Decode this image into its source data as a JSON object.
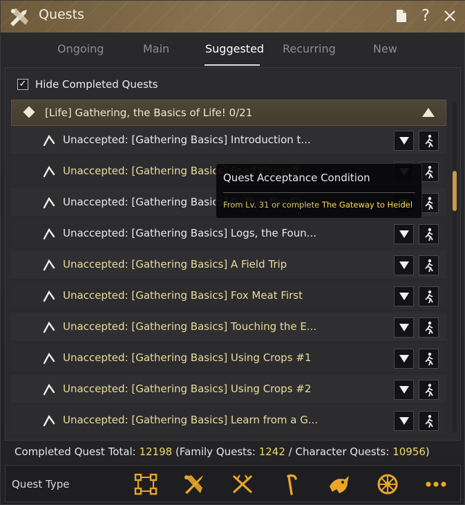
{
  "window": {
    "title": "Quests"
  },
  "tabs": [
    {
      "label": "Ongoing"
    },
    {
      "label": "Main"
    },
    {
      "label": "Suggested",
      "active": true
    },
    {
      "label": "Recurring"
    },
    {
      "label": "New"
    }
  ],
  "filter": {
    "hide_completed_label": "Hide Completed Quests",
    "checked": true
  },
  "group": {
    "title": "[Life] Gathering, the Basics of Life! 0/21"
  },
  "quests": [
    {
      "text": "Unaccepted: [Gathering Basics] Introduction t...",
      "style": "white"
    },
    {
      "text": "Unaccepted: [Gathering Basics] Feed Yourself",
      "style": "yellow"
    },
    {
      "text": "Unaccepted: [Gathering Basics] Gather the Fir...",
      "style": "white"
    },
    {
      "text": "Unaccepted: [Gathering Basics] Logs, the Foun...",
      "style": "white"
    },
    {
      "text": "Unaccepted: [Gathering Basics] A Field Trip",
      "style": "yellow"
    },
    {
      "text": "Unaccepted: [Gathering Basics] Fox Meat First",
      "style": "yellow"
    },
    {
      "text": "Unaccepted: [Gathering Basics] Touching the E...",
      "style": "yellow"
    },
    {
      "text": "Unaccepted: [Gathering Basics] Using Crops #1",
      "style": "yellow"
    },
    {
      "text": "Unaccepted: [Gathering Basics] Using Crops #2",
      "style": "yellow"
    },
    {
      "text": "Unaccepted: [Gathering Basics] Learn from a G...",
      "style": "yellow"
    }
  ],
  "tooltip": {
    "title": "Quest Acceptance Condition",
    "body_prefix": "From Lv. 31 or complete ",
    "body_highlight": "The Gateway to Heidel"
  },
  "totals": {
    "label": "Completed Quest Total: ",
    "total": "12198",
    "family_label": " (Family Quests: ",
    "family": "1242",
    "character_label": " / Character Quests: ",
    "character": "10956",
    "close": ")"
  },
  "bottom": {
    "quest_type_label": "Quest Type",
    "type_icons": [
      "select-all-icon",
      "combat-icon",
      "life-icon",
      "gathering-icon",
      "fishing-icon",
      "sailing-icon",
      "more-icon"
    ]
  },
  "colors": {
    "accent_gold": "#c89a48",
    "quest_yellow": "#e9dc9b",
    "number_yellow": "#f0d96a",
    "titlebar": "#7a6443"
  }
}
